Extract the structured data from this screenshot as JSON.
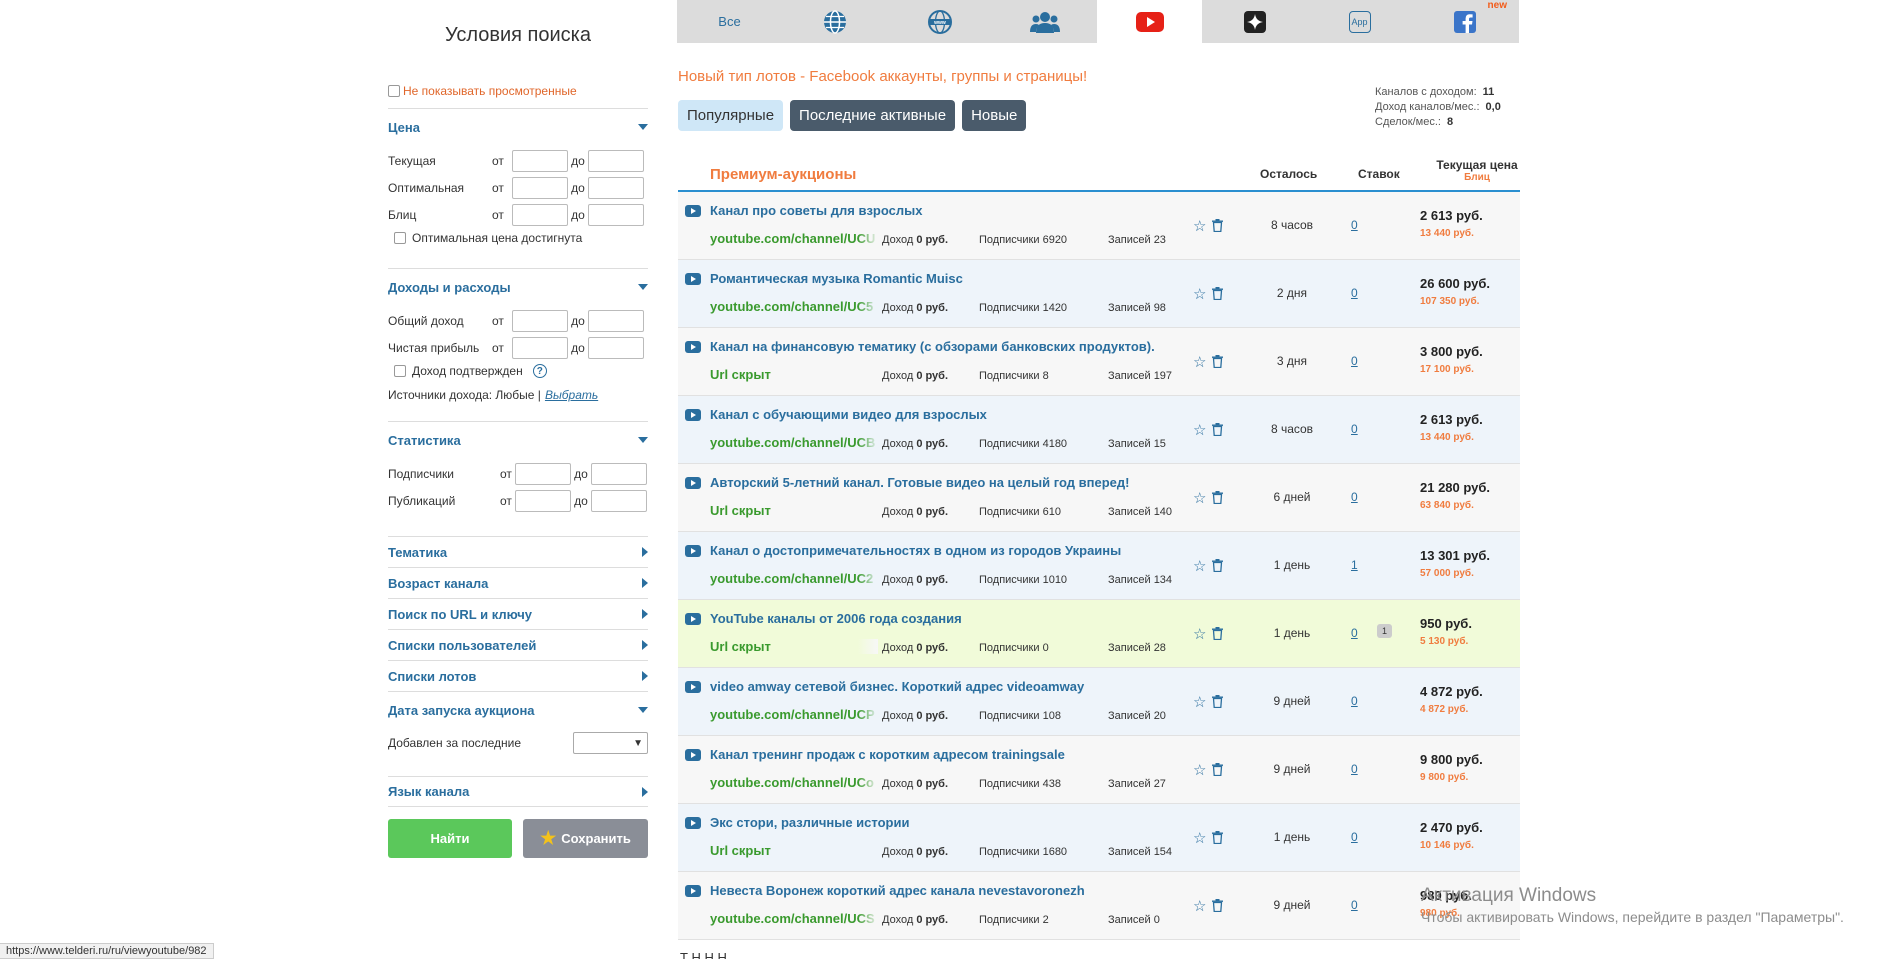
{
  "sidebar": {
    "title": "Условия поиска",
    "hide_viewed": "Не показывать просмотренные",
    "from": "от",
    "to": "до",
    "price": {
      "title": "Цена",
      "rows": [
        "Текущая",
        "Оптимальная",
        "Блиц"
      ],
      "check": "Оптимальная цена достигнута"
    },
    "income": {
      "title": "Доходы и расходы",
      "rows": [
        "Общий доход",
        "Чистая прибыль"
      ],
      "check": "Доход подтвержден",
      "sources_label": "Источники дохода: Любые |",
      "sources_link": "Выбрать"
    },
    "stats": {
      "title": "Статистика",
      "rows": [
        "Подписчики",
        "Публикаций"
      ]
    },
    "collapsed": [
      "Тематика",
      "Возраст канала",
      "Поиск по URL и ключу",
      "Списки пользователей",
      "Списки лотов"
    ],
    "launch": {
      "title": "Дата запуска аукциона",
      "label": "Добавлен за последние"
    },
    "language": "Язык канала",
    "find_button": "Найти",
    "save_button": "Сохранить"
  },
  "topnav": {
    "tabs": [
      {
        "label": "Все",
        "icon": "all"
      },
      {
        "label": "",
        "icon": "globe-icon"
      },
      {
        "label": "",
        "icon": "www-icon"
      },
      {
        "label": "",
        "icon": "group-icon"
      },
      {
        "label": "",
        "icon": "youtube-icon",
        "active": true
      },
      {
        "label": "",
        "icon": "sparkle-icon"
      },
      {
        "label": "App",
        "icon": "app-icon"
      },
      {
        "label": "",
        "icon": "facebook-icon"
      }
    ],
    "new_badge": "new"
  },
  "promo": "Новый тип лотов - Facebook аккаунты, группы и страницы!",
  "stats": {
    "channels_label": "Каналов с доходом:",
    "channels": "11",
    "income_label": "Доход каналов/мес.:",
    "income": "0,0",
    "deals_label": "Сделок/мес.:",
    "deals": "8"
  },
  "filters": [
    "Популярные",
    "Последние активные",
    "Новые"
  ],
  "list": {
    "title": "Премиум-аукционы",
    "col_left": "Осталось",
    "col_bids": "Ставок",
    "col_price": "Текущая цена",
    "col_blitz": "Блиц",
    "income_label": "Доход",
    "subs_label": "Подписчики",
    "posts_label": "Записей",
    "rows": [
      {
        "title": "Канал про советы для взрослых",
        "url": "youtube.com/channel/UCU",
        "income": "0 руб.",
        "subs": "6920",
        "posts": "23",
        "left": "8 часов",
        "bids": "0",
        "price": "2 613 руб.",
        "blitz": "13 440 руб."
      },
      {
        "title": "Романтическая музыка Romantic Muisc",
        "url": "youtube.com/channel/UC5",
        "income": "0 руб.",
        "subs": "1420",
        "posts": "98",
        "left": "2 дня",
        "bids": "0",
        "price": "26 600 руб.",
        "blitz": "107 350 руб."
      },
      {
        "title": "Канал на финансовую тематику (с обзорами банковских продуктов).",
        "url": "Url скрыт",
        "income": "0 руб.",
        "subs": "8",
        "posts": "197",
        "left": "3 дня",
        "bids": "0",
        "price": "3 800 руб.",
        "blitz": "17 100 руб."
      },
      {
        "title": "Канал с обучающими видео для взрослых",
        "url": "youtube.com/channel/UCB",
        "income": "0 руб.",
        "subs": "4180",
        "posts": "15",
        "left": "8 часов",
        "bids": "0",
        "price": "2 613 руб.",
        "blitz": "13 440 руб."
      },
      {
        "title": "Авторский 5-летний канал. Готовые видео на целый год вперед!",
        "url": "Url скрыт",
        "income": "0 руб.",
        "subs": "610",
        "posts": "140",
        "left": "6 дней",
        "bids": "0",
        "price": "21 280 руб.",
        "blitz": "63 840 руб."
      },
      {
        "title": "Канал о достопримечательностях в одном из городов Украины",
        "url": "youtube.com/channel/UC2",
        "income": "0 руб.",
        "subs": "1010",
        "posts": "134",
        "left": "1 день",
        "bids": "1",
        "price": "13 301 руб.",
        "blitz": "57 000 руб."
      },
      {
        "title": "YouTube каналы от 2006 года создания",
        "url": "Url скрыт",
        "income": "0 руб.",
        "subs": "0",
        "posts": "28",
        "left": "1 день",
        "bids": "0",
        "bubble": "1",
        "price": "950 руб.",
        "blitz": "5 130 руб."
      },
      {
        "title": "video amway сетевой бизнес. Короткий адрес videoamway",
        "url": "youtube.com/channel/UCP",
        "income": "0 руб.",
        "subs": "108",
        "posts": "20",
        "left": "9 дней",
        "bids": "0",
        "price": "4 872 руб.",
        "blitz": "4 872 руб."
      },
      {
        "title": "Канал тренинг продаж с коротким адресом trainingsale",
        "url": "youtube.com/channel/UCo",
        "income": "0 руб.",
        "subs": "438",
        "posts": "27",
        "left": "9 дней",
        "bids": "0",
        "price": "9 800 руб.",
        "blitz": "9 800 руб."
      },
      {
        "title": "Экс стори, различные истории",
        "url": "Url скрыт",
        "income": "0 руб.",
        "subs": "1680",
        "posts": "154",
        "left": "1 день",
        "bids": "0",
        "price": "2 470 руб.",
        "blitz": "10 146 руб."
      },
      {
        "title": "Невеста Воронеж короткий адрес канала nevestavoronezh",
        "url": "youtube.com/channel/UCS",
        "income": "0 руб.",
        "subs": "2",
        "posts": "0",
        "left": "9 дней",
        "bids": "0",
        "price": "980 руб.",
        "blitz": "980 руб."
      }
    ]
  },
  "cut_text": "Т                    Н  Н   Н",
  "statusbar": "https://www.telderi.ru/ru/viewyoutube/982",
  "watermark": {
    "line1": "Активация Windows",
    "line2": "Чтобы активировать Windows, перейдите в раздел \"Параметры\"."
  },
  "colors": {
    "accent_blue": "#2a6e9e",
    "orange": "#f07c3f",
    "green": "#5bc85b",
    "youtube_red": "#e62117",
    "facebook_blue": "#3b75c9"
  }
}
